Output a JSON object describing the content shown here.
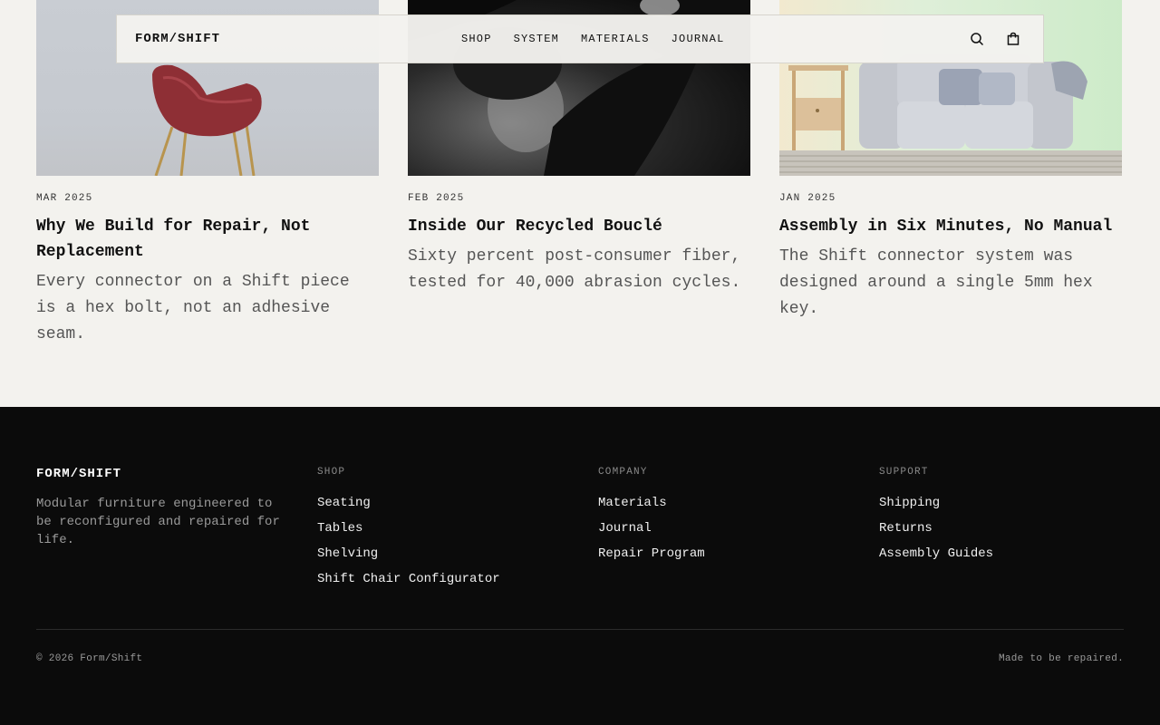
{
  "header": {
    "logo": "FORM/SHIFT",
    "nav": [
      "SHOP",
      "SYSTEM",
      "MATERIALS",
      "JOURNAL"
    ],
    "icons": [
      "search-icon",
      "shopping-bag-icon"
    ]
  },
  "journal": {
    "posts": [
      {
        "date": "MAR 2025",
        "title": "Why We Build for Repair, Not Replacement",
        "excerpt": "Every connector on a Shift piece is a hex bolt, not an adhesive seam."
      },
      {
        "date": "FEB 2025",
        "title": "Inside Our Recycled Bouclé",
        "excerpt": "Sixty percent post-consumer fiber, tested for 40,000 abrasion cycles."
      },
      {
        "date": "JAN 2025",
        "title": "Assembly in Six Minutes, No Manual",
        "excerpt": "The Shift connector system was designed around a single 5mm hex key."
      }
    ]
  },
  "footer": {
    "logo": "FORM/SHIFT",
    "tagline": "Modular furniture engineered to be reconfigured and repaired for life.",
    "columns": [
      {
        "title": "SHOP",
        "links": [
          "Seating",
          "Tables",
          "Shelving",
          "Shift Chair Configurator"
        ]
      },
      {
        "title": "COMPANY",
        "links": [
          "Materials",
          "Journal",
          "Repair Program"
        ]
      },
      {
        "title": "SUPPORT",
        "links": [
          "Shipping",
          "Returns",
          "Assembly Guides"
        ]
      }
    ],
    "copyright": "© 2026 Form/Shift",
    "note": "Made to be repaired."
  },
  "colors": {
    "background": "#f3f2ee",
    "footer_bg": "#0b0b0b",
    "text": "#111111",
    "muted": "#555555"
  }
}
